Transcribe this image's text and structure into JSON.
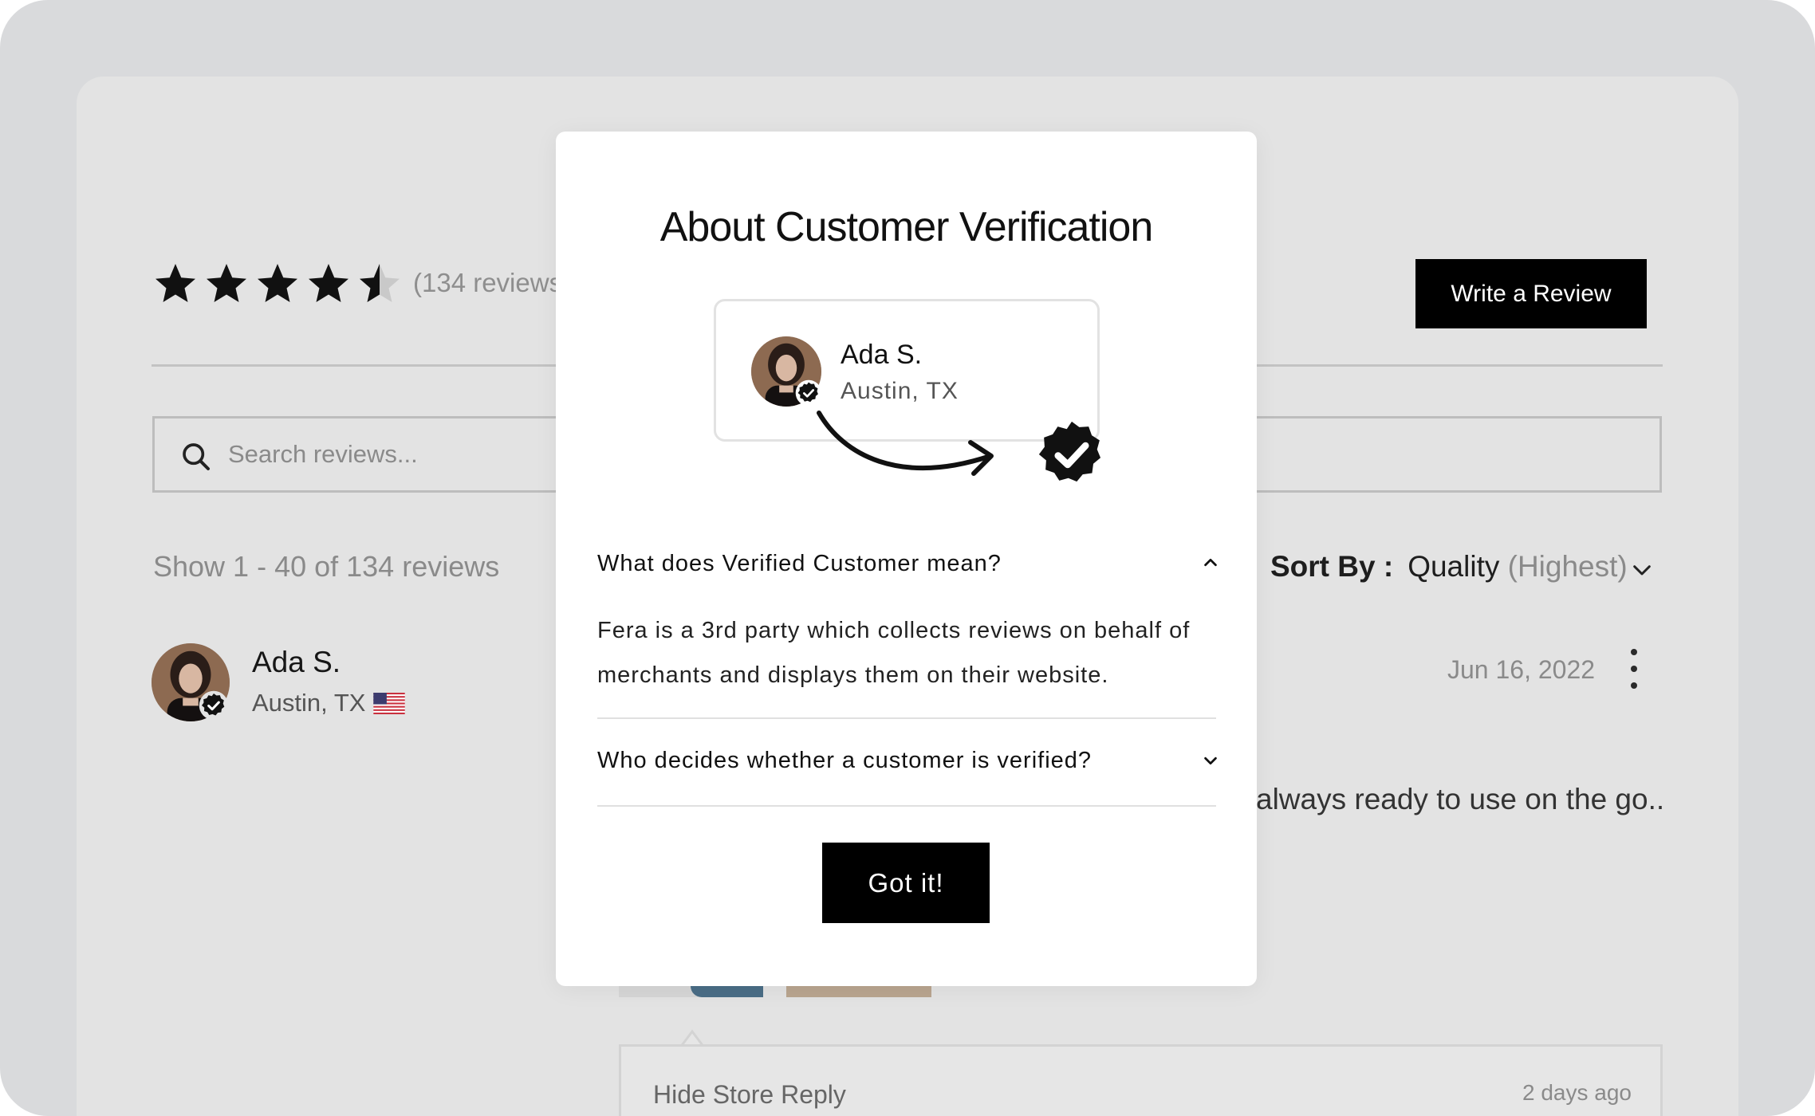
{
  "summary": {
    "rating": 4.5,
    "max_rating": 5,
    "review_count_text": "(134 reviews",
    "write_review_label": "Write a Review"
  },
  "search": {
    "placeholder": "Search reviews..."
  },
  "listing": {
    "count_text": "Show 1 - 40 of 134 reviews",
    "sort_label": "Sort By :",
    "sort_value": "Quality",
    "sort_qualifier": "(Highest)"
  },
  "review": {
    "name": "Ada S.",
    "location": "Austin, TX",
    "date": "Jun 16, 2022",
    "snippet": "always ready to use on the go..",
    "reply_toggle": "Hide Store Reply",
    "reply_time": "2 days ago"
  },
  "modal": {
    "title": "About Customer Verification",
    "demo": {
      "name": "Ada S.",
      "location": "Austin, TX"
    },
    "faq": [
      {
        "question": "What does Verified Customer mean?",
        "expanded": true,
        "answer_lines": [
          "Fera is a 3rd party which collects reviews on behalf of",
          "merchants and displays them on their website."
        ]
      },
      {
        "question": "Who decides whether a customer is verified?",
        "expanded": false
      }
    ],
    "confirm_label": "Got it!"
  },
  "colors": {
    "accent": "#000000",
    "backdrop": "#d9dadc",
    "page": "#e3e3e3",
    "muted_text": "#8a8a8a"
  },
  "icons": [
    "star-icon",
    "star-half-icon",
    "search-icon",
    "chevron-down-icon",
    "chevron-up-icon",
    "kebab-menu-icon",
    "verified-badge-icon",
    "curved-arrow-icon",
    "us-flag-icon"
  ]
}
